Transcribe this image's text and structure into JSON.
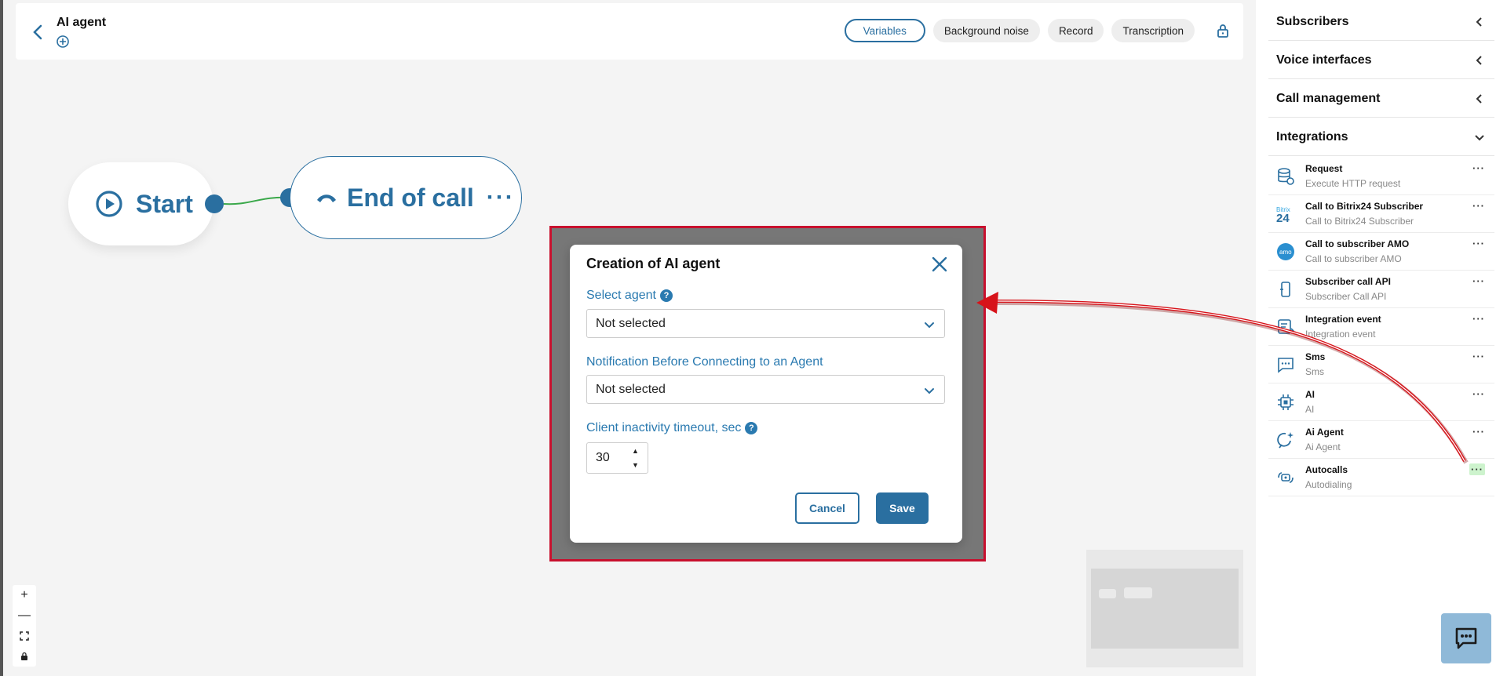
{
  "header": {
    "title": "AI agent",
    "tabs": [
      "Variables",
      "Background noise",
      "Record",
      "Transcription"
    ]
  },
  "flow": {
    "start_label": "Start",
    "end_label": "End of call",
    "end_more": "···"
  },
  "modal": {
    "title": "Creation of AI agent",
    "field1_label": "Select agent",
    "field1_value": "Not selected",
    "field2_label": "Notification Before Connecting to an Agent",
    "field2_value": "Not selected",
    "field3_label": "Client inactivity timeout, sec",
    "field3_value": "30",
    "help_glyph": "?",
    "cancel": "Cancel",
    "save": "Save"
  },
  "zoom": {
    "plus": "+",
    "minus": "—"
  },
  "sidebar": {
    "sections": [
      {
        "label": "Subscribers"
      },
      {
        "label": "Voice interfaces"
      },
      {
        "label": "Call management"
      },
      {
        "label": "Integrations"
      }
    ],
    "items": [
      {
        "name": "Request",
        "desc": "Execute HTTP request",
        "icon": "database-icon"
      },
      {
        "name": "Call to Bitrix24 Subscriber",
        "desc": "Call to Bitrix24 Subscriber",
        "icon": "bitrix24-icon"
      },
      {
        "name": "Call to subscriber AMO",
        "desc": "Call to subscriber AMO",
        "icon": "amo-icon"
      },
      {
        "name": "Subscriber call API",
        "desc": "Subscriber Call API",
        "icon": "phone-api-icon"
      },
      {
        "name": "Integration event",
        "desc": "Integration event",
        "icon": "event-icon"
      },
      {
        "name": "Sms",
        "desc": "Sms",
        "icon": "message-icon"
      },
      {
        "name": "AI",
        "desc": "AI",
        "icon": "chip-icon"
      },
      {
        "name": "Ai Agent",
        "desc": "Ai Agent",
        "icon": "ai-agent-icon"
      },
      {
        "name": "Autocalls",
        "desc": "Autodialing",
        "icon": "autocall-icon"
      }
    ],
    "dots": "···"
  },
  "colors": {
    "accent": "#2a6fa0",
    "highlight": "#c8102e"
  }
}
